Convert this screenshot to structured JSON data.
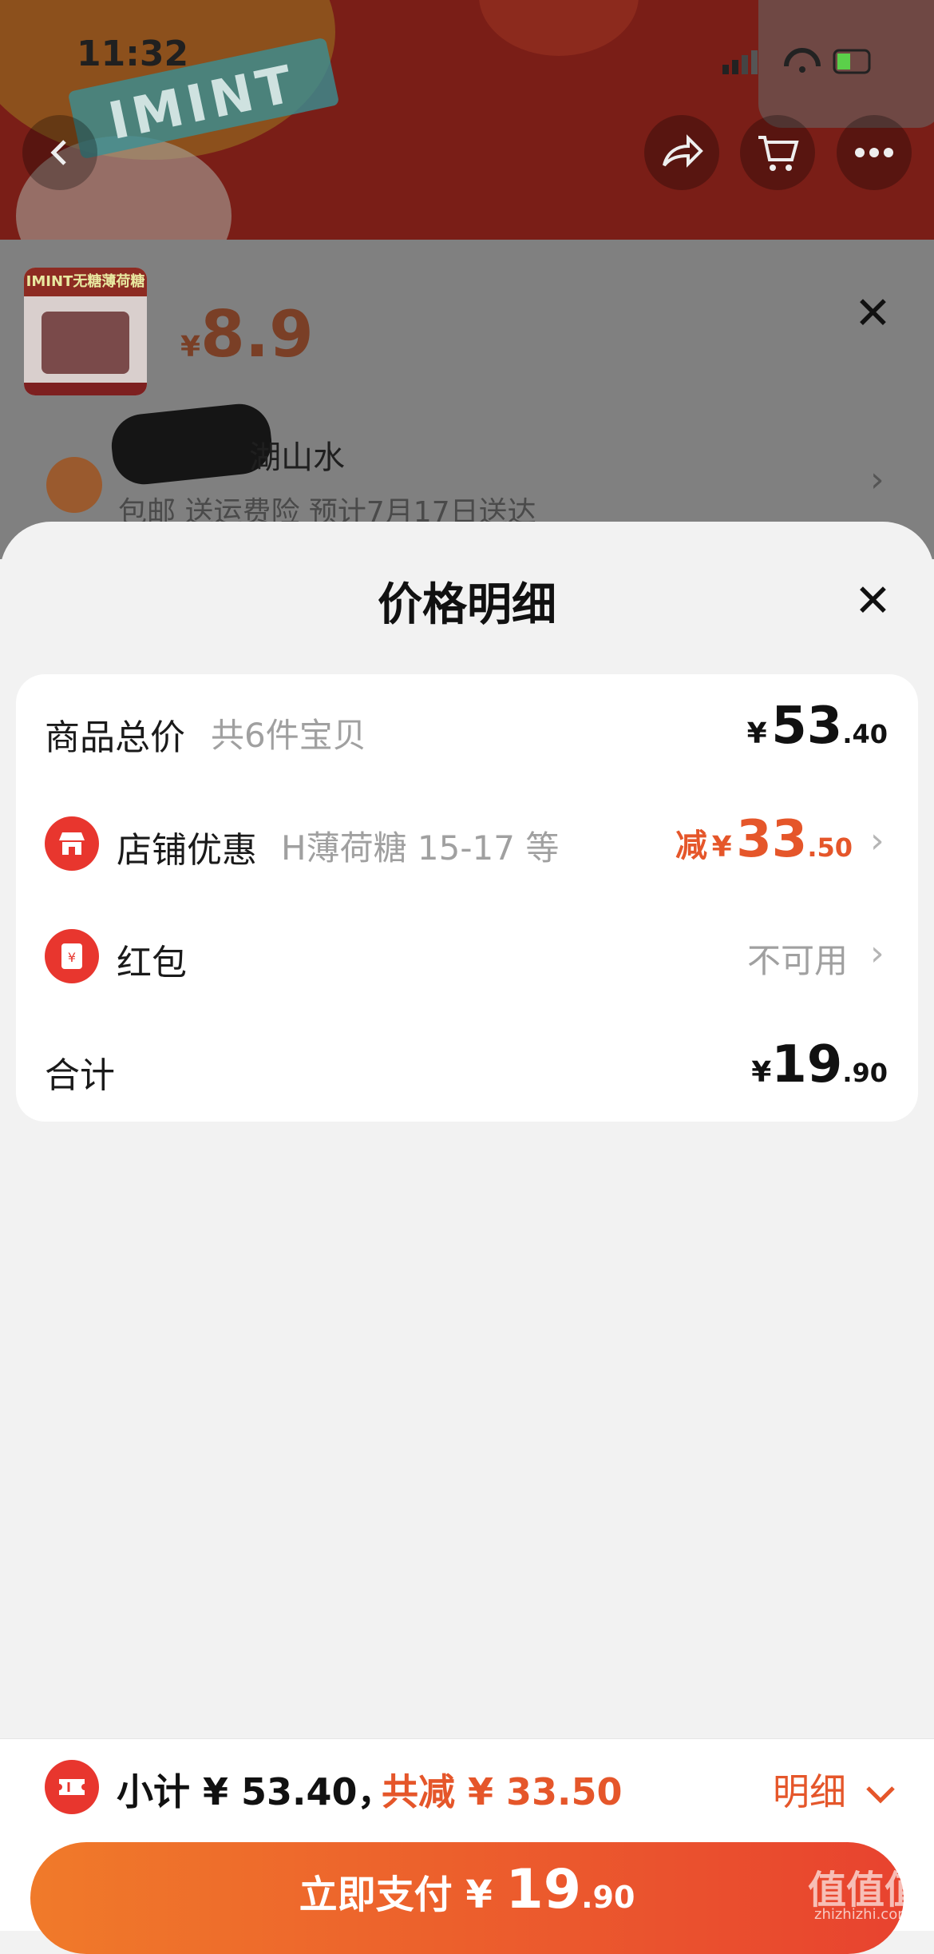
{
  "status_bar": {
    "time": "11:32"
  },
  "hero": {
    "brand_logo_text": "IMINT"
  },
  "product_popup": {
    "thumb_band_text": "IMINT无糖薄荷糖",
    "price_currency": "¥",
    "price_value": "8.9",
    "address_visible": "湖山水",
    "shipping_line": "包邮  送运费险  预计7月17日送达"
  },
  "sheet": {
    "title": "价格明细",
    "close_label": "✕",
    "rows": [
      {
        "label": "商品总价",
        "sub": "共6件宝贝",
        "currency": "¥",
        "int": "53",
        "dec": ".40"
      },
      {
        "label": "店铺优惠",
        "sub": "H薄荷糖 15-17 等",
        "prefix": "减",
        "currency": "¥",
        "int": "33",
        "dec": ".50"
      },
      {
        "label": "红包",
        "status": "不可用"
      },
      {
        "label": "合计",
        "currency": "¥",
        "int": "19",
        "dec": ".90"
      }
    ]
  },
  "footer": {
    "subtotal_text": "小计 ¥ 53.40，",
    "discount_text": "共减 ¥ 33.50",
    "detail_label": "明细",
    "pay_label": "立即支付",
    "pay_currency": "¥",
    "pay_int": "19",
    "pay_dec": ".90"
  },
  "watermark": {
    "main": "值值值",
    "sub": "zhizhizhi.com"
  },
  "colors": {
    "accent": "#e5562a",
    "icon_red": "#e8362e",
    "pay_gradient_start": "#f07a2a",
    "pay_gradient_end": "#e8432f"
  }
}
